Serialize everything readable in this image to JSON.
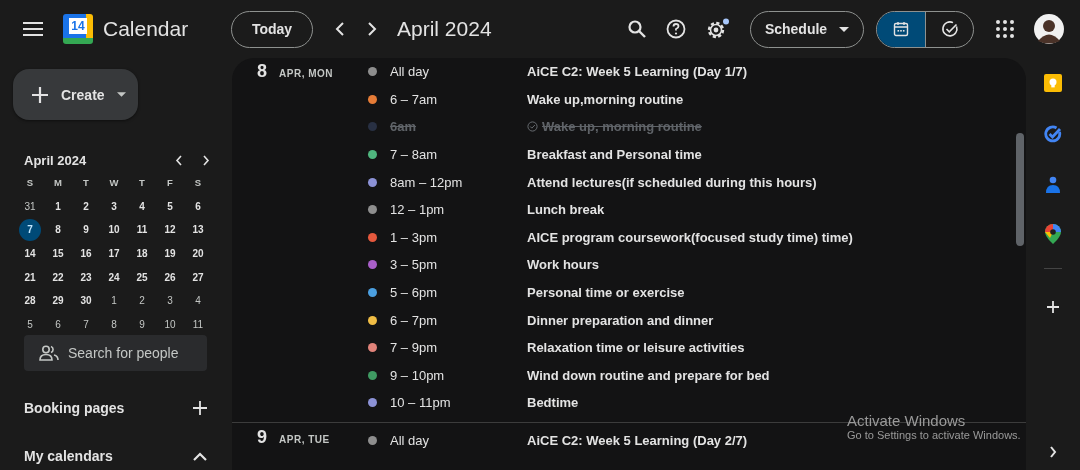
{
  "header": {
    "app_name": "Calendar",
    "logo_day": "14",
    "today_button": "Today",
    "period_title": "April 2024",
    "settings_badge": true,
    "view_menu": "Schedule",
    "mode_toggle": [
      {
        "kind": "calendar",
        "selected": true
      },
      {
        "kind": "tasks",
        "selected": false
      }
    ]
  },
  "sidebar": {
    "create_button": "Create",
    "mini_calendar": {
      "title": "April 2024",
      "weekdays": [
        "S",
        "M",
        "T",
        "W",
        "T",
        "F",
        "S"
      ],
      "weeks": [
        [
          {
            "label": "31",
            "outside": true,
            "selected": false
          },
          {
            "label": "1",
            "outside": false,
            "selected": false
          },
          {
            "label": "2",
            "outside": false,
            "selected": false
          },
          {
            "label": "3",
            "outside": false,
            "selected": false
          },
          {
            "label": "4",
            "outside": false,
            "selected": false
          },
          {
            "label": "5",
            "outside": false,
            "selected": false
          },
          {
            "label": "6",
            "outside": false,
            "selected": false
          }
        ],
        [
          {
            "label": "7",
            "outside": false,
            "selected": true
          },
          {
            "label": "8",
            "outside": false,
            "selected": false
          },
          {
            "label": "9",
            "outside": false,
            "selected": false
          },
          {
            "label": "10",
            "outside": false,
            "selected": false
          },
          {
            "label": "11",
            "outside": false,
            "selected": false
          },
          {
            "label": "12",
            "outside": false,
            "selected": false
          },
          {
            "label": "13",
            "outside": false,
            "selected": false
          }
        ],
        [
          {
            "label": "14",
            "outside": false,
            "selected": false
          },
          {
            "label": "15",
            "outside": false,
            "selected": false
          },
          {
            "label": "16",
            "outside": false,
            "selected": false
          },
          {
            "label": "17",
            "outside": false,
            "selected": false
          },
          {
            "label": "18",
            "outside": false,
            "selected": false
          },
          {
            "label": "19",
            "outside": false,
            "selected": false
          },
          {
            "label": "20",
            "outside": false,
            "selected": false
          }
        ],
        [
          {
            "label": "21",
            "outside": false,
            "selected": false
          },
          {
            "label": "22",
            "outside": false,
            "selected": false
          },
          {
            "label": "23",
            "outside": false,
            "selected": false
          },
          {
            "label": "24",
            "outside": false,
            "selected": false
          },
          {
            "label": "25",
            "outside": false,
            "selected": false
          },
          {
            "label": "26",
            "outside": false,
            "selected": false
          },
          {
            "label": "27",
            "outside": false,
            "selected": false
          }
        ],
        [
          {
            "label": "28",
            "outside": false,
            "selected": false
          },
          {
            "label": "29",
            "outside": false,
            "selected": false
          },
          {
            "label": "30",
            "outside": false,
            "selected": false
          },
          {
            "label": "1",
            "outside": true,
            "selected": false
          },
          {
            "label": "2",
            "outside": true,
            "selected": false
          },
          {
            "label": "3",
            "outside": true,
            "selected": false
          },
          {
            "label": "4",
            "outside": true,
            "selected": false
          }
        ],
        [
          {
            "label": "5",
            "outside": true,
            "selected": false
          },
          {
            "label": "6",
            "outside": true,
            "selected": false
          },
          {
            "label": "7",
            "outside": true,
            "selected": false
          },
          {
            "label": "8",
            "outside": true,
            "selected": false
          },
          {
            "label": "9",
            "outside": true,
            "selected": false
          },
          {
            "label": "10",
            "outside": true,
            "selected": false
          },
          {
            "label": "11",
            "outside": true,
            "selected": false
          }
        ]
      ]
    },
    "people_search": {
      "placeholder": "Search for people"
    },
    "sections": [
      {
        "label": "Booking pages",
        "kind": "add"
      },
      {
        "label": "My calendars",
        "kind": "collapse",
        "expanded": true
      }
    ]
  },
  "schedule": [
    {
      "day": "8",
      "date_label": "APR, MON",
      "events": [
        {
          "time": "All day",
          "title": "AiCE C2: Week 5 Learning (Day 1/7)",
          "color": "#8e8e8e",
          "done": false
        },
        {
          "time": "6 – 7am",
          "title": "Wake up,morning routine",
          "color": "#e67c37",
          "done": false
        },
        {
          "time": "6am",
          "title": "Wake up, morning routine",
          "color": "#283043",
          "done": true
        },
        {
          "time": "7 – 8am",
          "title": "Breakfast and Personal time",
          "color": "#4fb57e",
          "done": false
        },
        {
          "time": "8am – 12pm",
          "title": "Attend lectures(if scheduled during this hours)",
          "color": "#8c92d6",
          "done": false
        },
        {
          "time": "12 – 1pm",
          "title": "Lunch break",
          "color": "#8e8e8e",
          "done": false
        },
        {
          "time": "1 – 3pm",
          "title": "AICE program coursework(focused study time) time)",
          "color": "#e5583d",
          "done": false
        },
        {
          "time": "3 – 5pm",
          "title": "Work hours",
          "color": "#a95fc9",
          "done": false
        },
        {
          "time": "5 – 6pm",
          "title": "Personal time or exercise",
          "color": "#4b9fe0",
          "done": false
        },
        {
          "time": "6 – 7pm",
          "title": "Dinner preparation and dinner",
          "color": "#f0bd45",
          "done": false
        },
        {
          "time": "7 – 9pm",
          "title": "Relaxation time or leisure activities",
          "color": "#e1837a",
          "done": false
        },
        {
          "time": "9 – 10pm",
          "title": "Wind down routine and prepare for bed",
          "color": "#3f9a62",
          "done": false
        },
        {
          "time": "10 – 11pm",
          "title": "Bedtime",
          "color": "#8c92d6",
          "done": false
        }
      ]
    },
    {
      "day": "9",
      "date_label": "APR, TUE",
      "events": [
        {
          "time": "All day",
          "title": "AiCE C2: Week 5 Learning (Day 2/7)",
          "color": "#8e8e8e",
          "done": false
        }
      ]
    }
  ],
  "os_notice": {
    "title": "Activate Windows",
    "message": "Go to Settings to activate Windows."
  }
}
